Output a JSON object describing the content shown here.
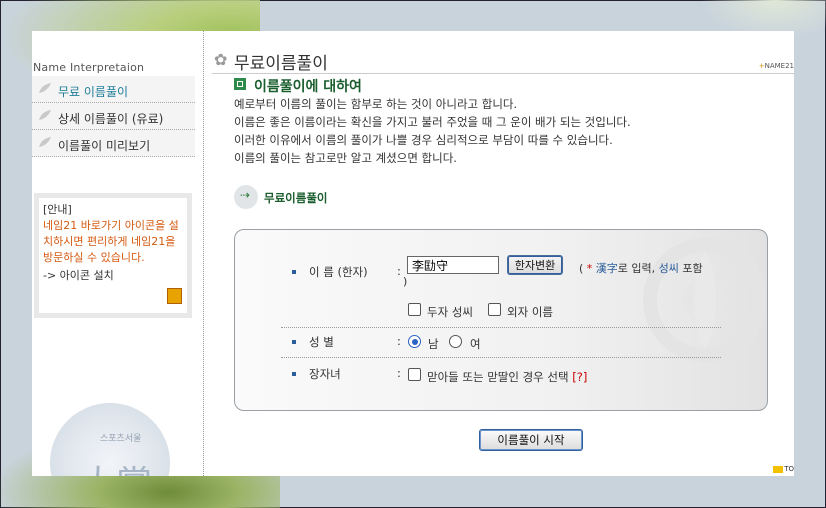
{
  "sidebar": {
    "title": "Name Interpretaion",
    "items": [
      {
        "label": "무료 이름풀이"
      },
      {
        "label": "상세 이름풀이 (유료)"
      },
      {
        "label": "이름풀이 미리보기"
      }
    ],
    "notice": {
      "head": "[안내]",
      "body": "네임21 바로가기 아이콘을 설치하시면 편리하게 네임21을 방문하실 수 있습니다.",
      "link": "-> 아이콘 설치"
    },
    "award": {
      "small": "스포츠서울",
      "big": "大賞"
    }
  },
  "main": {
    "page_title": "무료이름풀이",
    "brand": "NAME21",
    "section_title": "이름풀이에 대하여",
    "description": [
      "예로부터 이름의 풀이는 함부로 하는 것이 아니라고 합니다.",
      "이름은 좋은 이름이라는 확신을 가지고 불러 주었을 때 그 운이 배가 되는 것입니다.",
      "이러한 이유에서 이름의 풀이가 나쁠 경우 심리적으로 부담이 따를 수 있습니다.",
      "이름의 풀이는 참고로만 알고 계셨으면 합니다."
    ],
    "sub_title": "무료이름풀이"
  },
  "form": {
    "name_label": "이 름 (한자)",
    "name_value": "李劻守",
    "convert_button": "한자변환",
    "hint_open": "( ",
    "hint_req": "* ",
    "hint_hanja": "漢字",
    "hint_mid": "로 입력, ",
    "hint_surname": "성씨",
    "hint_end": " 포함",
    "hint_close": ")",
    "option_two_char_surname": "두자 성씨",
    "option_single_name": "외자 이름",
    "gender_label": "성 별",
    "gender_male": "남",
    "gender_female": "여",
    "eldest_label": "장자녀",
    "eldest_option": "맏아들 또는 맏딸인 경우 선택",
    "help_mark": "[?]",
    "colon": ":"
  },
  "start_button": "이름풀이 시작",
  "top_link": "TO"
}
